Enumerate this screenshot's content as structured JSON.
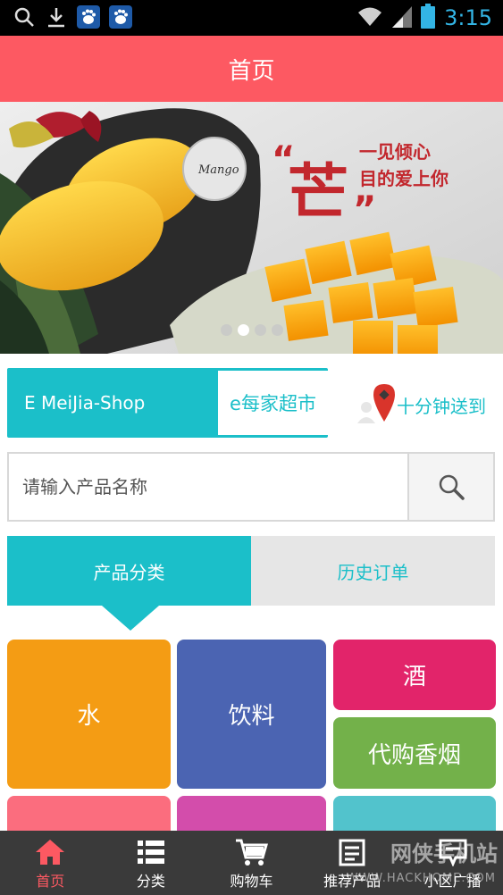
{
  "status_bar": {
    "time": "3:15"
  },
  "header": {
    "title": "首页"
  },
  "banner": {
    "slogan_line1": "一见倾心",
    "slogan_line2": "目的爱上你",
    "big_char": "芒",
    "quote_open": "“",
    "quote_close": "”",
    "tag_text": "Mango",
    "pages": 4,
    "active_page": 1
  },
  "shop": {
    "name_en": "E MeiJia-Shop",
    "name_cn": "e每家超市",
    "delivery": "十分钟送到"
  },
  "search": {
    "placeholder": "请输入产品名称"
  },
  "tabs": [
    {
      "label": "产品分类"
    },
    {
      "label": "历史订单"
    }
  ],
  "tiles": [
    {
      "label": "水",
      "color": "#f49c14"
    },
    {
      "label": "饮料",
      "color": "#4b64b2"
    },
    {
      "label": "酒",
      "color": "#e2246a"
    },
    {
      "label": "代购香烟",
      "color": "#73b14a"
    }
  ],
  "tile_colors_partial": [
    "#fb6d7e",
    "#d34dab",
    "#52c3cc"
  ],
  "bottom_nav": [
    {
      "label": "首页",
      "icon": "home-icon",
      "active": true
    },
    {
      "label": "分类",
      "icon": "list-icon",
      "active": false
    },
    {
      "label": "购物车",
      "icon": "cart-icon",
      "active": false
    },
    {
      "label": "推荐产品",
      "icon": "recommend-icon",
      "active": false
    },
    {
      "label": "小区广播",
      "icon": "broadcast-icon",
      "active": false
    }
  ],
  "watermark": {
    "text": "网侠手机站",
    "sub": "WWW.HACKHOME.COM"
  },
  "colors": {
    "accent": "#1bbfc9",
    "header": "#fd5962",
    "nav_bg": "#3a3a3a"
  }
}
